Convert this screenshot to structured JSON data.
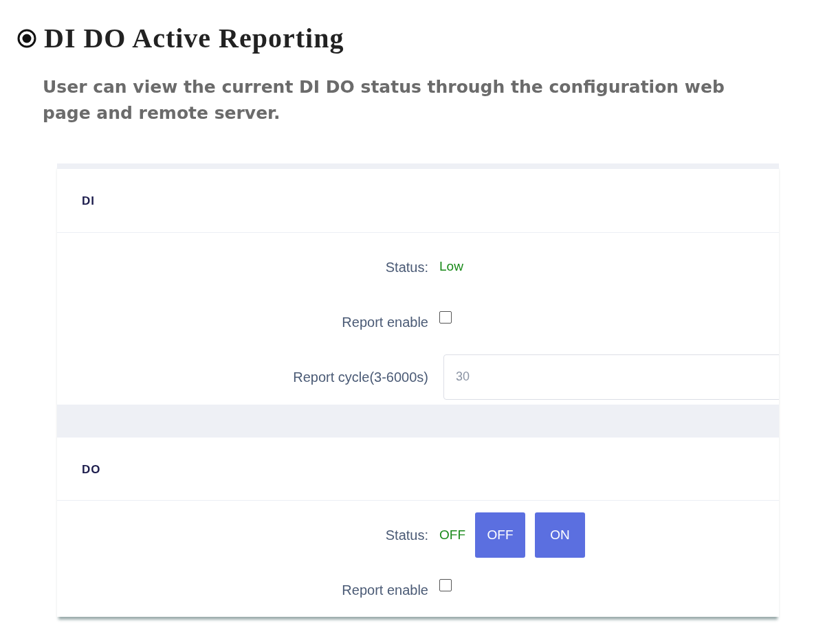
{
  "title": "DI DO Active Reporting",
  "description": "User can view the current DI DO status through the configuration web page and remote server.",
  "sections": [
    {
      "title": "DI",
      "rows": [
        {
          "kind": "status",
          "label": "Status:",
          "value": "Low"
        },
        {
          "kind": "checkbox",
          "label": "Report enable",
          "checked": false
        },
        {
          "kind": "input",
          "label": "Report cycle(3-6000s)",
          "value": "30"
        }
      ]
    },
    {
      "title": "DO",
      "rows": [
        {
          "kind": "status",
          "label": "Status:",
          "value": "OFF",
          "buttons": [
            "OFF",
            "ON"
          ]
        },
        {
          "kind": "checkbox",
          "label": "Report enable",
          "checked": false
        }
      ]
    }
  ]
}
